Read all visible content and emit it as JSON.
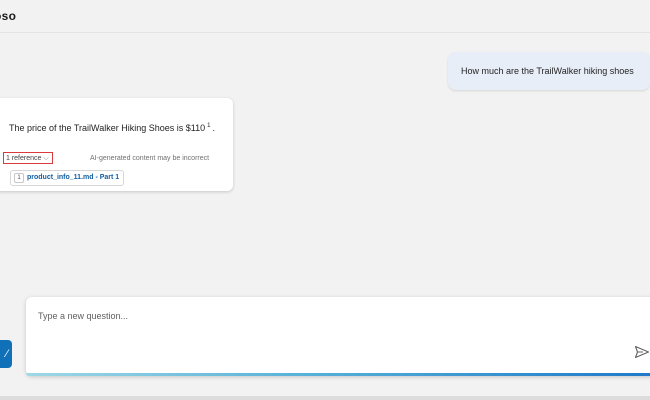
{
  "header": {
    "title": "oso"
  },
  "conversation": {
    "user_message": "How much are the TrailWalker hiking shoes",
    "answer": {
      "text": "The price of the TrailWalker Hiking Shoes is $110",
      "citation_marker": "1",
      "trailing": ".",
      "references_toggle": "1 reference",
      "disclaimer": "AI-generated content may be incorrect",
      "references": [
        {
          "number": "1",
          "name": "product_info_11.md - Part 1"
        }
      ]
    }
  },
  "input": {
    "placeholder": "Type a new question...",
    "value": ""
  },
  "icons": {
    "send": "send-icon",
    "chevron": "chevron-down-icon",
    "side_button": "broom-icon"
  },
  "colors": {
    "accent": "#1070b8",
    "link": "#115ea3",
    "highlight_border": "#d83b3b",
    "user_bubble": "#e8eef8"
  }
}
